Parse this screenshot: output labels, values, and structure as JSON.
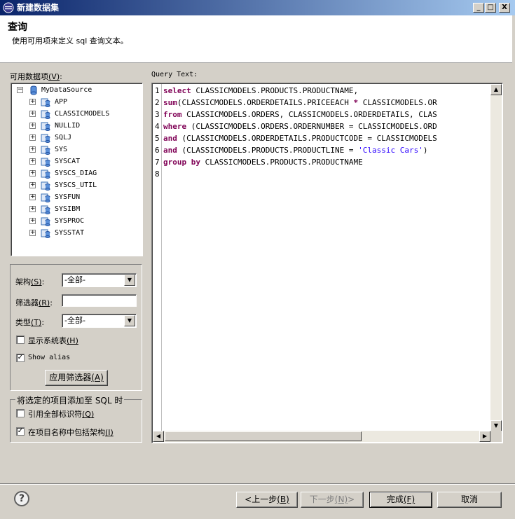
{
  "window": {
    "title": "新建数据集",
    "minimize": "_",
    "maximize": "□",
    "close": "X"
  },
  "header": {
    "title": "查询",
    "description": "使用可用项来定义 sql 查询文本。"
  },
  "available": {
    "label": "可用数据项",
    "mnemonic": "(V)",
    "colon": ":",
    "root": "MyDataSource",
    "schemas": [
      "APP",
      "CLASSICMODELS",
      "NULLID",
      "SQLJ",
      "SYS",
      "SYSCAT",
      "SYSCS_DIAG",
      "SYSCS_UTIL",
      "SYSFUN",
      "SYSIBM",
      "SYSPROC",
      "SYSSTAT"
    ]
  },
  "filters": {
    "schema_label": "架构",
    "schema_mn": "(S)",
    "schema_value": "-全部-",
    "filter_label": "筛选器",
    "filter_mn": "(R)",
    "filter_value": "",
    "type_label": "类型",
    "type_mn": "(T)",
    "type_value": "-全部-",
    "colon": ":",
    "show_system_label": "显示系统表",
    "show_system_mn": "(H)",
    "show_system_checked": false,
    "show_alias_label": "Show alias",
    "show_alias_checked": true,
    "apply_label": "应用筛选器",
    "apply_mn": "(A)"
  },
  "add_group": {
    "title": "将选定的项目添加至 SQL 时",
    "quote_label": "引用全部标识符",
    "quote_mn": "(Q)",
    "quote_checked": false,
    "include_schema_label": "在项目名称中包括架构",
    "include_schema_mn": "(I)",
    "include_schema_checked": true
  },
  "query": {
    "label": "Query Text:",
    "lines": [
      {
        "n": "1",
        "kw": "select",
        "rest": " CLASSICMODELS.PRODUCTS.PRODUCTNAME,",
        "str": "",
        "tail": ""
      },
      {
        "n": "2",
        "kw": "sum",
        "rest": "(CLASSICMODELS.ORDERDETAILS.PRICEEACH ",
        "str": "",
        "tail": "",
        "op": "*",
        "after": " CLASSICMODELS.OR"
      },
      {
        "n": "3",
        "kw": "from",
        "rest": " CLASSICMODELS.ORDERS, CLASSICMODELS.ORDERDETAILS, CLAS",
        "str": "",
        "tail": ""
      },
      {
        "n": "4",
        "kw": "where",
        "rest": " (CLASSICMODELS.ORDERS.ORDERNUMBER = CLASSICMODELS.ORD",
        "str": "",
        "tail": ""
      },
      {
        "n": "5",
        "kw": "and",
        "rest": " (CLASSICMODELS.ORDERDETAILS.PRODUCTCODE = CLASSICMODELS",
        "str": "",
        "tail": ""
      },
      {
        "n": "6",
        "kw": "and",
        "rest": " (CLASSICMODELS.PRODUCTS.PRODUCTLINE = ",
        "str": "'Classic Cars'",
        "tail": ")"
      },
      {
        "n": "7",
        "kw": "group by",
        "rest": " CLASSICMODELS.PRODUCTS.PRODUCTNAME",
        "str": "",
        "tail": ""
      },
      {
        "n": "8",
        "kw": "",
        "rest": "",
        "str": "",
        "tail": ""
      }
    ]
  },
  "footer": {
    "help": "?",
    "back_label": "<上一步",
    "back_mn": "(B)",
    "next_label": "下一步",
    "next_mn": "(N)",
    "next_suffix": ">",
    "finish_label": "完成",
    "finish_mn": "(F)",
    "cancel_label": "取消"
  }
}
